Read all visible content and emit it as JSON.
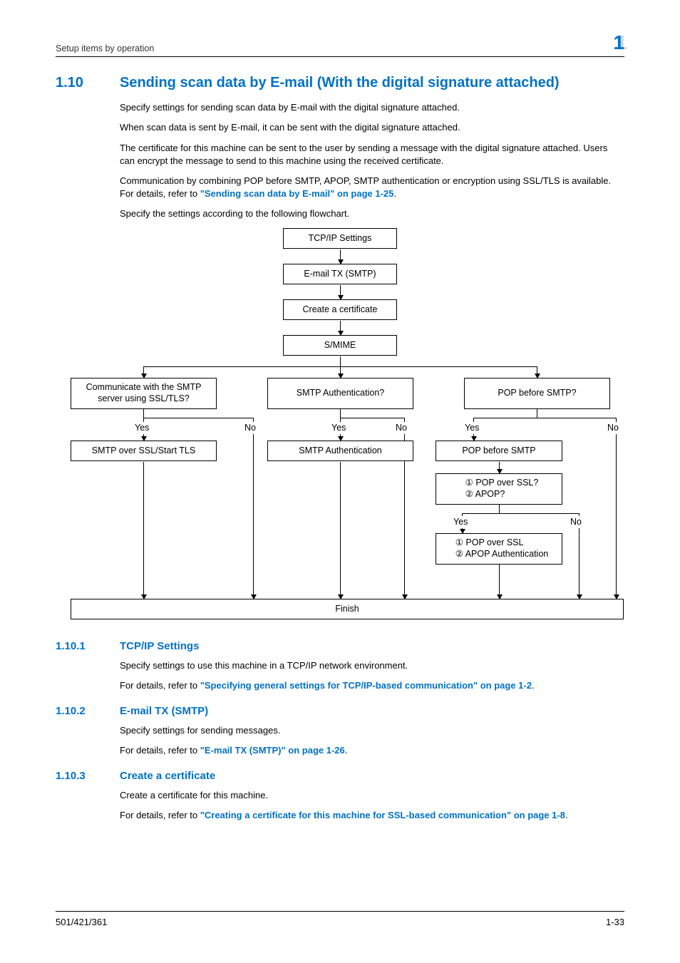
{
  "header": {
    "breadcrumb": "Setup items by operation",
    "chapter": "1"
  },
  "section": {
    "number": "1.10",
    "title": "Sending scan data by E-mail (With the digital signature attached)"
  },
  "paragraphs": {
    "p1": "Specify settings for sending scan data by E-mail with the digital signature attached.",
    "p2": "When scan data is sent by E-mail, it can be sent with the digital signature attached.",
    "p3": "The certificate for this machine can be sent to the user by sending a message with the digital signature attached. Users can encrypt the message to send to this machine using the received certificate.",
    "p4a": "Communication by combining POP before SMTP, APOP, SMTP authentication or encryption using SSL/TLS is available. For details, refer to ",
    "p4link": "\"Sending scan data by E-mail\" on page 1-25",
    "p4b": ".",
    "p5": "Specify the settings according to the following flowchart."
  },
  "flow": {
    "tcpip": "TCP/IP Settings",
    "emailtx": "E-mail TX (SMTP)",
    "createcert": "Create a certificate",
    "smime": "S/MIME",
    "q_ssl": "Communicate with the SMTP server using SSL/TLS?",
    "q_smtpauth": "SMTP Authentication?",
    "q_pop": "POP before SMTP?",
    "yes": "Yes",
    "no": "No",
    "a_ssl": "SMTP over SSL/Start TLS",
    "a_smtpauth": "SMTP Authentication",
    "a_pop": "POP before SMTP",
    "q_popssl": "① POP over SSL?\n② APOP?",
    "a_popssl": "① POP over SSL\n② APOP Authentication",
    "finish": "Finish"
  },
  "sub1": {
    "num": "1.10.1",
    "title": "TCP/IP Settings",
    "p1": "Specify settings to use this machine in a TCP/IP network environment.",
    "p2a": "For details, refer to ",
    "p2link": "\"Specifying general settings for TCP/IP-based communication\" on page 1-2",
    "p2b": "."
  },
  "sub2": {
    "num": "1.10.2",
    "title": "E-mail TX (SMTP)",
    "p1": "Specify settings for sending messages.",
    "p2a": "For details, refer to ",
    "p2link": "\"E-mail TX (SMTP)\" on page 1-26",
    "p2b": "."
  },
  "sub3": {
    "num": "1.10.3",
    "title": "Create a certificate",
    "p1": "Create a certificate for this machine.",
    "p2a": "For details, refer to ",
    "p2link": "\"Creating a certificate for this machine for SSL-based communication\" on page 1-8",
    "p2b": "."
  },
  "footer": {
    "left": "501/421/361",
    "right": "1-33"
  }
}
